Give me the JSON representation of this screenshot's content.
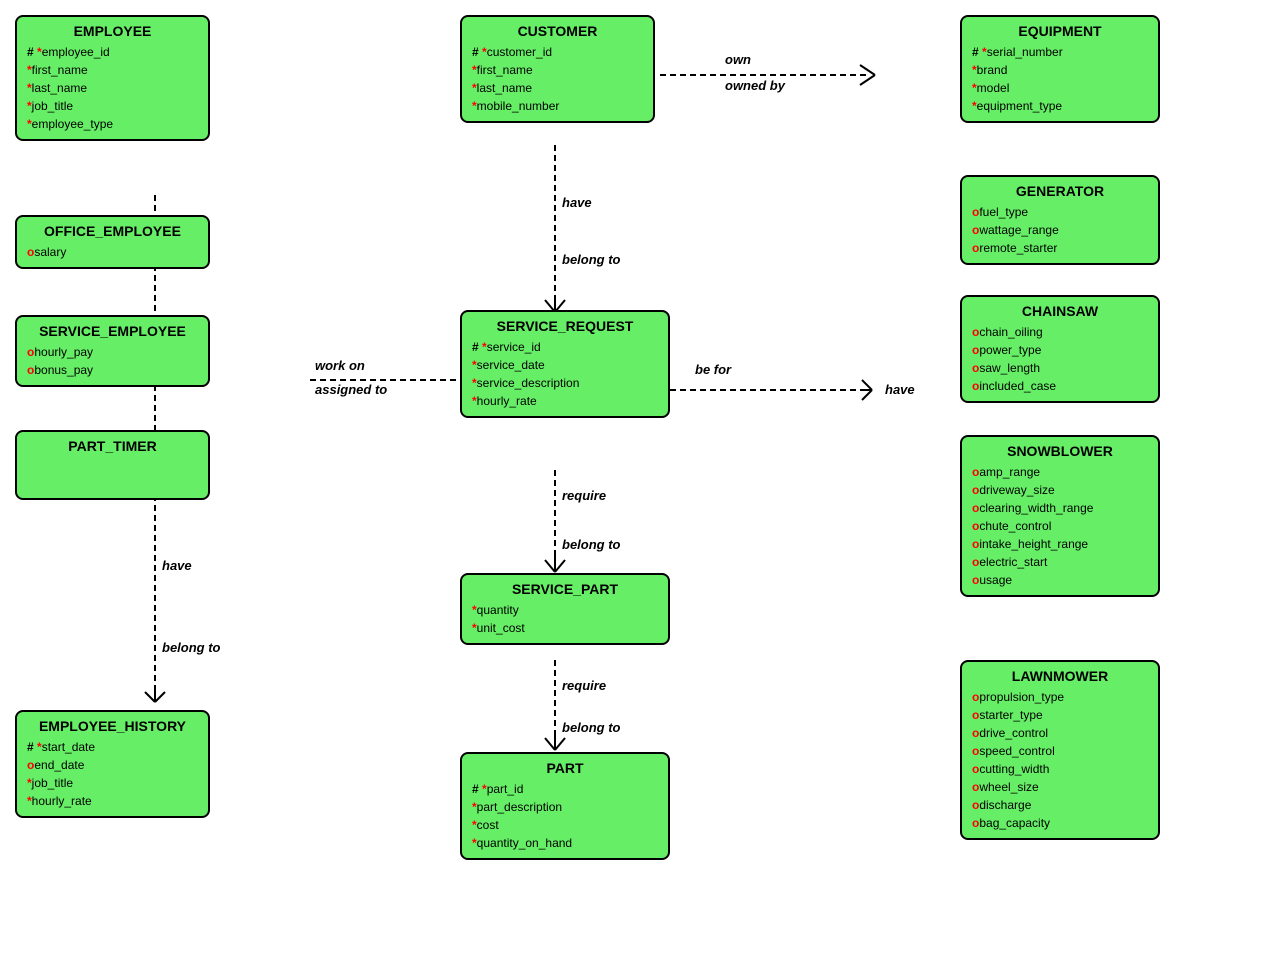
{
  "entities": {
    "employee": {
      "title": "EMPLOYEE",
      "fields": [
        {
          "type": "pk_required",
          "name": "employee_id"
        },
        {
          "type": "required",
          "name": "first_name"
        },
        {
          "type": "required",
          "name": "last_name"
        },
        {
          "type": "required",
          "name": "job_title"
        },
        {
          "type": "required",
          "name": "employee_type"
        }
      ]
    },
    "office_employee": {
      "title": "OFFICE_EMPLOYEE",
      "fields": [
        {
          "type": "optional",
          "name": "salary"
        }
      ]
    },
    "service_employee": {
      "title": "SERVICE_EMPLOYEE",
      "fields": [
        {
          "type": "optional",
          "name": "hourly_pay"
        },
        {
          "type": "optional",
          "name": "bonus_pay"
        }
      ]
    },
    "part_timer": {
      "title": "PART_TIMER",
      "fields": []
    },
    "employee_history": {
      "title": "EMPLOYEE_HISTORY",
      "fields": [
        {
          "type": "pk_required",
          "name": "start_date"
        },
        {
          "type": "optional",
          "name": "end_date"
        },
        {
          "type": "required",
          "name": "job_title"
        },
        {
          "type": "required",
          "name": "hourly_rate"
        }
      ]
    },
    "customer": {
      "title": "CUSTOMER",
      "fields": [
        {
          "type": "pk_required",
          "name": "customer_id"
        },
        {
          "type": "required",
          "name": "first_name"
        },
        {
          "type": "required",
          "name": "last_name"
        },
        {
          "type": "required",
          "name": "mobile_number"
        }
      ]
    },
    "service_request": {
      "title": "SERVICE_REQUEST",
      "fields": [
        {
          "type": "pk_required",
          "name": "service_id"
        },
        {
          "type": "required",
          "name": "service_date"
        },
        {
          "type": "required",
          "name": "service_description"
        },
        {
          "type": "required",
          "name": "hourly_rate"
        }
      ]
    },
    "service_part": {
      "title": "SERVICE_PART",
      "fields": [
        {
          "type": "required",
          "name": "quantity"
        },
        {
          "type": "required",
          "name": "unit_cost"
        }
      ]
    },
    "part": {
      "title": "PART",
      "fields": [
        {
          "type": "pk_required",
          "name": "part_id"
        },
        {
          "type": "required",
          "name": "part_description"
        },
        {
          "type": "required",
          "name": "cost"
        },
        {
          "type": "required",
          "name": "quantity_on_hand"
        }
      ]
    },
    "equipment": {
      "title": "EQUIPMENT",
      "fields": [
        {
          "type": "pk_required",
          "name": "serial_number"
        },
        {
          "type": "required",
          "name": "brand"
        },
        {
          "type": "required",
          "name": "model"
        },
        {
          "type": "required",
          "name": "equipment_type"
        }
      ]
    },
    "generator": {
      "title": "GENERATOR",
      "fields": [
        {
          "type": "optional",
          "name": "fuel_type"
        },
        {
          "type": "optional",
          "name": "wattage_range"
        },
        {
          "type": "optional",
          "name": "remote_starter"
        }
      ]
    },
    "chainsaw": {
      "title": "CHAINSAW",
      "fields": [
        {
          "type": "optional",
          "name": "chain_oiling"
        },
        {
          "type": "optional",
          "name": "power_type"
        },
        {
          "type": "optional",
          "name": "saw_length"
        },
        {
          "type": "optional",
          "name": "included_case"
        }
      ]
    },
    "snowblower": {
      "title": "SNOWBLOWER",
      "fields": [
        {
          "type": "optional",
          "name": "amp_range"
        },
        {
          "type": "optional",
          "name": "driveway_size"
        },
        {
          "type": "optional",
          "name": "clearing_width_range"
        },
        {
          "type": "optional",
          "name": "chute_control"
        },
        {
          "type": "optional",
          "name": "intake_height_range"
        },
        {
          "type": "optional",
          "name": "electric_start"
        },
        {
          "type": "optional",
          "name": "usage"
        }
      ]
    },
    "lawnmower": {
      "title": "LAWNMOWER",
      "fields": [
        {
          "type": "optional",
          "name": "propulsion_type"
        },
        {
          "type": "optional",
          "name": "starter_type"
        },
        {
          "type": "optional",
          "name": "drive_control"
        },
        {
          "type": "optional",
          "name": "speed_control"
        },
        {
          "type": "optional",
          "name": "cutting_width"
        },
        {
          "type": "optional",
          "name": "wheel_size"
        },
        {
          "type": "optional",
          "name": "discharge"
        },
        {
          "type": "optional",
          "name": "bag_capacity"
        }
      ]
    }
  },
  "relations": {
    "own": "own",
    "owned_by": "owned by",
    "have_customer": "have",
    "belong_to_customer": "belong to",
    "be_for": "be for",
    "have_equipment": "have",
    "work_on": "work on",
    "assigned_to": "assigned to",
    "have_employee": "have",
    "belong_to_employee": "belong to",
    "require_service": "require",
    "belong_to_service": "belong to",
    "require_part": "require",
    "belong_to_part": "belong to"
  }
}
